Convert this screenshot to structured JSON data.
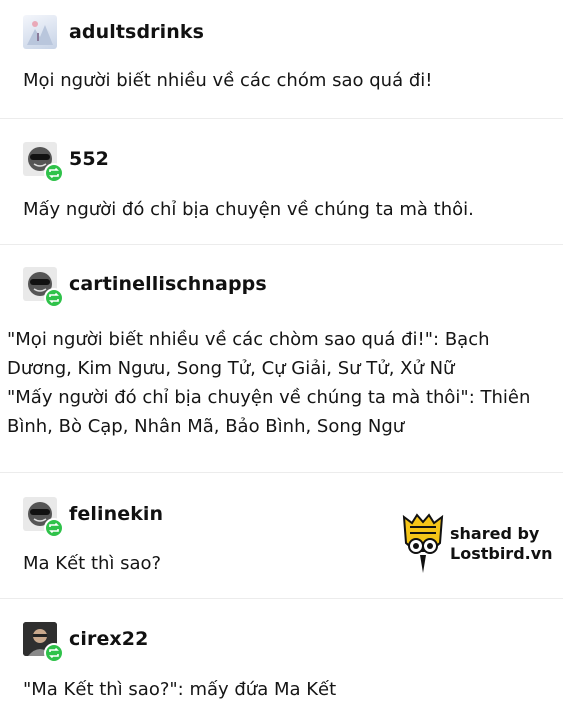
{
  "posts": [
    {
      "username": "adultsdrinks",
      "avatar_icon": "snowy-photo-avatar-icon",
      "text": "Mọi người biết nhiều về các chóm sao quá đi!"
    },
    {
      "username": "552",
      "avatar_icon": "sunglasses-face-avatar-icon",
      "reblog_icon": "reblog-icon",
      "text": "Mấy người đó chỉ bịa chuyện về chúng ta mà thôi."
    },
    {
      "username": "cartinellischnapps",
      "avatar_icon": "sunglasses-face-avatar-icon",
      "reblog_icon": "reblog-icon",
      "lines": [
        "\"Mọi người biết nhiều về các chòm sao quá đi!\": Bạch Dương, Kim Ngưu, Song Tử, Cự Giải, Sư Tử, Xử Nữ",
        "\"Mấy người đó chỉ bịa chuyện về chúng ta mà thôi\": Thiên Bình, Bò Cạp, Nhân Mã, Bảo Bình, Song Ngư"
      ]
    },
    {
      "username": "felinekin",
      "avatar_icon": "sunglasses-face-avatar-icon",
      "reblog_icon": "reblog-icon",
      "text": "Ma Kết thì sao?"
    },
    {
      "username": "cirex22",
      "avatar_icon": "person-photo-avatar-icon",
      "reblog_icon": "reblog-icon",
      "text": "\"Ma Kết thì sao?\": mấy đứa Ma Kết"
    }
  ],
  "watermark": {
    "line1": "shared by",
    "line2": "Lostbird.vn",
    "logo_icon": "owl-logo-icon"
  },
  "colors": {
    "reblog_badge": "#2fc24a",
    "divider": "#ececec",
    "logo_yellow": "#f5c518"
  }
}
